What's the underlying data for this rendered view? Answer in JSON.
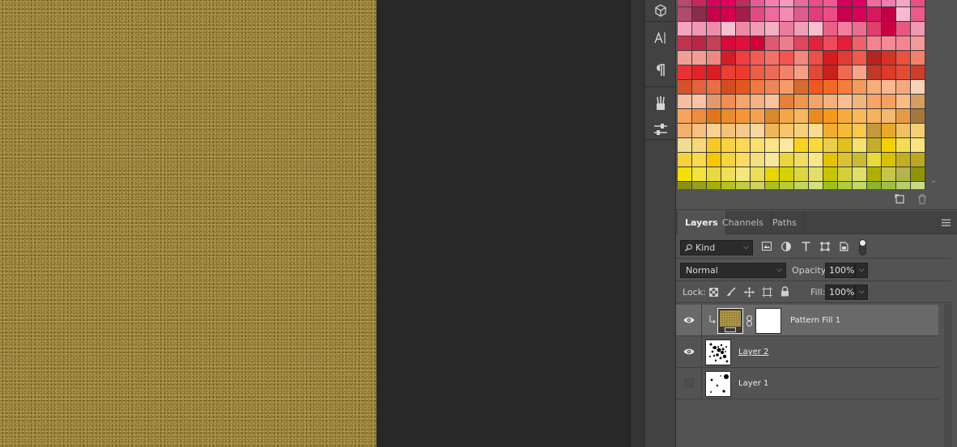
{
  "toolstrip": {
    "icons": [
      "3d-cube-icon",
      "character-icon",
      "paragraph-icon",
      "brush-presets-icon",
      "adjustments-icon"
    ]
  },
  "swatches": {
    "rows": [
      [
        "#b9486e",
        "#c4285e",
        "#d8005a",
        "#e0005c",
        "#ba2e5b",
        "#e75b99",
        "#f47fae",
        "#f59bbf",
        "#e86a9d",
        "#eb4d88",
        "#ef5b91",
        "#d5005a",
        "#df0064",
        "#f06aa0",
        "#ee7eae",
        "#f3a6c3",
        "#eb4e83"
      ],
      [
        "#b04b6a",
        "#8a2c4a",
        "#c8004c",
        "#d4004e",
        "#a31c4a",
        "#e04b86",
        "#f06a9d",
        "#f28ab2",
        "#dd5b8f",
        "#e23d7a",
        "#ea4d86",
        "#c6004d",
        "#d80059",
        "#d9195f",
        "#c20046",
        "#f7b9d1",
        "#ec5a8b"
      ],
      [
        "#f3a5bf",
        "#ef97b5",
        "#ef8ca9",
        "#f7c0d2",
        "#ec8aa6",
        "#f39bb4",
        "#f5aec4",
        "#ea7d9d",
        "#f09fb7",
        "#f7bfd0",
        "#e95f86",
        "#f17fa0",
        "#eb6d8f",
        "#e03e6c",
        "#cb0043",
        "#e9577f",
        "#f298b2"
      ],
      [
        "#c3314d",
        "#b8274a",
        "#c84057",
        "#d80a39",
        "#e0103c",
        "#d50036",
        "#e15970",
        "#ec7d8f",
        "#e0475f",
        "#e3223e",
        "#ef4a5c",
        "#e51f39",
        "#f0606f",
        "#f58290",
        "#f58a92",
        "#f58690",
        "#f5989c"
      ],
      [
        "#f19f96",
        "#f39c94",
        "#f08783",
        "#d01f2a",
        "#ee3e3f",
        "#f15d55",
        "#f2726b",
        "#ef564f",
        "#f4877e",
        "#e95148",
        "#d41e1e",
        "#e13c33",
        "#f05a4c",
        "#b32423",
        "#d23427",
        "#e9503e",
        "#f4806a"
      ],
      [
        "#e83334",
        "#e1242c",
        "#dc1e24",
        "#e84035",
        "#ed3c2d",
        "#ef5c45",
        "#ec6b57",
        "#f2826c",
        "#f79e87",
        "#e24a37",
        "#c8221c",
        "#ee6a52",
        "#f5a58b",
        "#c0392b",
        "#dc3a2a",
        "#e54b34",
        "#ce3d2d"
      ],
      [
        "#d5522b",
        "#e3633e",
        "#ea6d45",
        "#d14e1e",
        "#e1581e",
        "#f3783d",
        "#ec8656",
        "#f79a6a",
        "#d96a2f",
        "#f0561e",
        "#f26a22",
        "#f47e3b",
        "#f59a5c",
        "#f7ad78",
        "#fbb792",
        "#f5a97b",
        "#f9d2b5"
      ],
      [
        "#f5bea0",
        "#fac3a6",
        "#e3996b",
        "#f18e56",
        "#f5a56d",
        "#f4b184",
        "#f8c29b",
        "#e57f3b",
        "#f0974f",
        "#f4a469",
        "#f6b07c",
        "#f9bf92",
        "#f4b57d",
        "#f8a36a",
        "#f3a060",
        "#fbbb85",
        "#d79c62"
      ],
      [
        "#f5a35d",
        "#ee8e3c",
        "#e0751c",
        "#e98b2e",
        "#f39638",
        "#f5a150",
        "#d8892c",
        "#f3a748",
        "#f7b660",
        "#ea8a1e",
        "#f5991e",
        "#f7ab3e",
        "#f9b85a",
        "#f4b35c",
        "#f2b970",
        "#e79a45",
        "#a8763f"
      ],
      [
        "#f2b16d",
        "#f7bf80",
        "#fad093",
        "#f5c27a",
        "#f6c98c",
        "#f9d79f",
        "#f0b55a",
        "#f6c46c",
        "#f9cf7a",
        "#fbdb8f",
        "#f2ad32",
        "#f7bb3a",
        "#f9c94d",
        "#c39a3d",
        "#e8a82a",
        "#f2c060",
        "#f4d071"
      ],
      [
        "#eedc92",
        "#f5d97b",
        "#f7c823",
        "#fad13e",
        "#fcd955",
        "#fbe06f",
        "#fde586",
        "#fee79f",
        "#f8d21e",
        "#fcd838",
        "#ead049",
        "#e2c11e",
        "#f7e271",
        "#c5ac2a",
        "#f2d200",
        "#f6dc50",
        "#f7e47c"
      ],
      [
        "#f5d23c",
        "#f9da4a",
        "#f5c800",
        "#f7d43b",
        "#f9dc62",
        "#f4e07d",
        "#f7e79d",
        "#e9d63f",
        "#f0dd62",
        "#f6e888",
        "#e5c300",
        "#d8c337",
        "#c8bb38",
        "#e8dc3c",
        "#d7c200",
        "#c0af23",
        "#bba81e"
      ],
      [
        "#f3e100",
        "#f4e43a",
        "#e7da3e",
        "#efe055",
        "#f3e77e",
        "#ecde59",
        "#e9d600",
        "#d6d200",
        "#dcd63f",
        "#e3de6b",
        "#c5c500",
        "#d3d13a",
        "#dfe06a",
        "#aeb000",
        "#c6c64e",
        "#b2b44c",
        "#8f9500"
      ],
      [
        "#8a8f1c",
        "#9a9f21",
        "#a2b000",
        "#b4c21e",
        "#c2cc3d",
        "#cdd45e",
        "#a8c11e",
        "#b7cc3d",
        "#c3d65e",
        "#d4e07e",
        "#9cc11d",
        "#b0cd3c",
        "#c3d866",
        "#8bb42c",
        "#9fc045",
        "#b5d06a",
        "#c7da83"
      ],
      [
        "#b9c841",
        "#c4d230",
        "#a5c21e",
        "#8fba20",
        "#8dc23b",
        "#a6cf56",
        "#b9d873",
        "#62ae34",
        "#7ab645",
        "#96c45c",
        "#55a63a",
        "#52b14a",
        "#7cc16c",
        "#9ecf86",
        "#b6dca0",
        "#a0cc92",
        "#c9e4b6"
      ]
    ]
  },
  "layers_panel": {
    "tabs": [
      "Layers",
      "Channels",
      "Paths"
    ],
    "active_tab": "Layers",
    "filter": {
      "value": "Kind",
      "icons": [
        "pixel-filter-icon",
        "adjustment-filter-icon",
        "type-filter-icon",
        "shape-filter-icon",
        "smart-object-filter-icon",
        "filter-toggle-icon"
      ]
    },
    "blend_mode": "Normal",
    "opacity_label": "Opacity:",
    "opacity_value": "100%",
    "lock_label": "Lock:",
    "fill_label": "Fill:",
    "fill_value": "100%",
    "layers": [
      {
        "name": "Pattern Fill 1",
        "visible": true,
        "selected": true
      },
      {
        "name": "Layer 2",
        "visible": true,
        "selected": false
      },
      {
        "name": "Layer 1",
        "visible": false,
        "selected": false
      }
    ]
  }
}
